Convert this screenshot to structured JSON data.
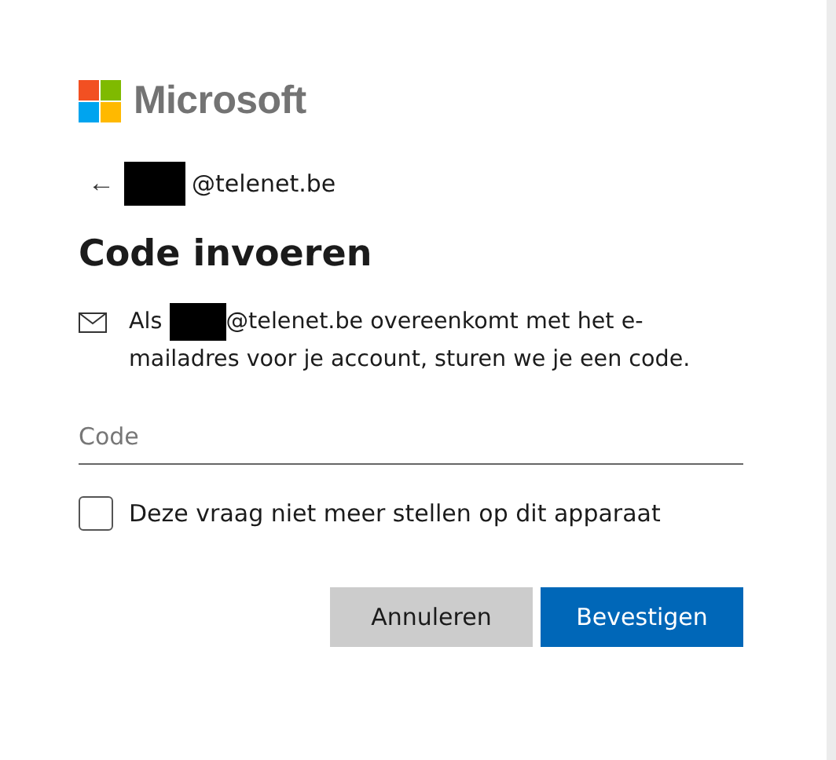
{
  "brand": {
    "name": "Microsoft"
  },
  "account": {
    "back": "←",
    "redacted": true,
    "domain": "@telenet.be"
  },
  "title": "Code invoeren",
  "message": {
    "before": "Als",
    "redacted": true,
    "after": "@telenet.be overeenkomt met het e-mailadres voor je account, sturen we je een code."
  },
  "code_field": {
    "placeholder": "Code"
  },
  "remember": {
    "label": "Deze vraag niet meer stellen op dit apparaat",
    "checked": false
  },
  "buttons": [
    {
      "label": "Annuleren",
      "kind": "secondary"
    },
    {
      "label": "Bevestigen",
      "kind": "primary"
    }
  ]
}
